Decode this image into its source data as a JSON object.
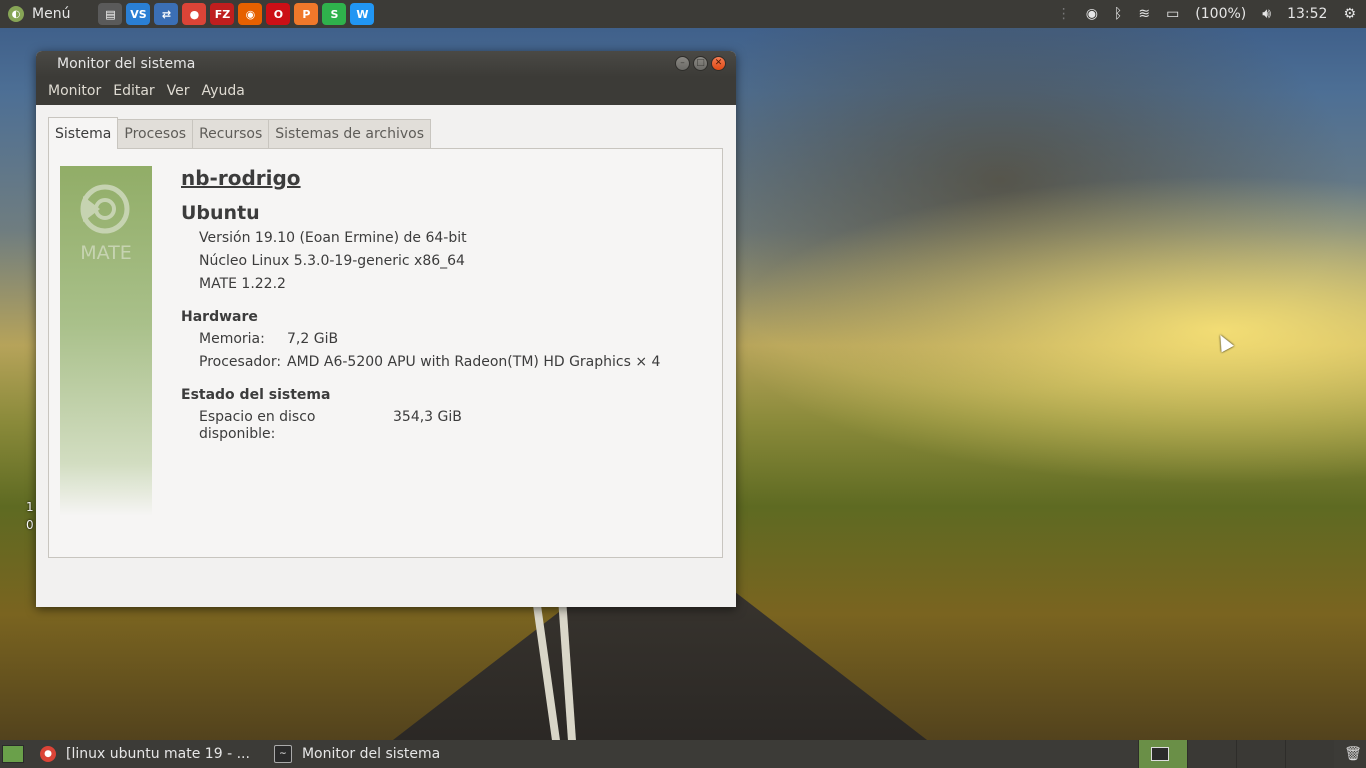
{
  "top_panel": {
    "menu_label": "Menú",
    "battery": "(100%)",
    "clock": "13:52",
    "launchers": [
      {
        "name": "files-icon",
        "glyph": "▤",
        "color": "#5a5a5a"
      },
      {
        "name": "vscode-icon",
        "glyph": "VS",
        "color": "#2a7fd4"
      },
      {
        "name": "network-icon",
        "glyph": "⇄",
        "color": "#3b6fb5"
      },
      {
        "name": "chrome-icon",
        "glyph": "●",
        "color": "#db4437"
      },
      {
        "name": "filezilla-icon",
        "glyph": "FZ",
        "color": "#bf1e1e"
      },
      {
        "name": "firefox-icon",
        "glyph": "◉",
        "color": "#e66000"
      },
      {
        "name": "opera-icon",
        "glyph": "O",
        "color": "#cc0f16"
      },
      {
        "name": "wps-presentation-icon",
        "glyph": "P",
        "color": "#f0782a"
      },
      {
        "name": "wps-spreadsheet-icon",
        "glyph": "S",
        "color": "#2fb24c"
      },
      {
        "name": "wps-writer-icon",
        "glyph": "W",
        "color": "#2196f3"
      }
    ]
  },
  "window": {
    "title": "Monitor del sistema",
    "menu": [
      "Monitor",
      "Editar",
      "Ver",
      "Ayuda"
    ],
    "tabs": [
      "Sistema",
      "Procesos",
      "Recursos",
      "Sistemas de archivos"
    ],
    "banner_text": "MATE",
    "hostname": "nb-rodrigo",
    "distro": "Ubuntu",
    "version": "Versión 19.10 (Eoan Ermine) de 64-bit",
    "kernel": "Núcleo Linux 5.3.0-19-generic x86_64",
    "mate_version": "MATE 1.22.2",
    "hardware_heading": "Hardware",
    "memory_label": "Memoria:",
    "memory_value": "7,2 GiB",
    "cpu_label": "Procesador:",
    "cpu_value": "AMD A6-5200 APU with Radeon(TM) HD Graphics × 4",
    "status_heading": "Estado del sistema",
    "disk_label": "Espacio en disco disponible:",
    "disk_value": "354,3 GiB"
  },
  "desktop_text": [
    "1",
    "0"
  ],
  "taskbar": {
    "tasks": [
      "[linux ubuntu mate 19 - ...",
      "Monitor del sistema"
    ]
  }
}
